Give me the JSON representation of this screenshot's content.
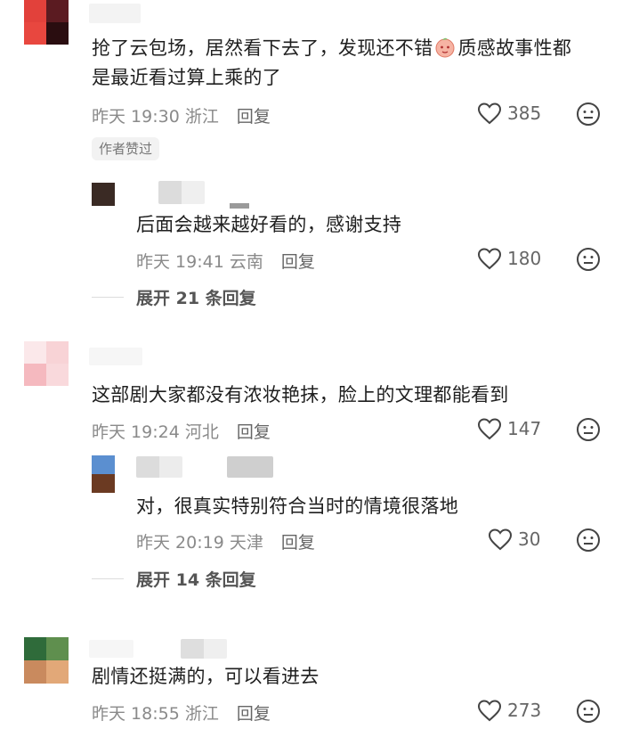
{
  "comments": [
    {
      "text_line1": "抢了云包场，居然看下去了，发现还不错",
      "text_line1b": "质感故事性都",
      "text_line2": "是最近看过算上乘的了",
      "time": "昨天 19:30",
      "location": "浙江",
      "reply_label": "回复",
      "likes": "385",
      "author_tag": "作者赞过",
      "reply": {
        "text": "后面会越来越好看的，感谢支持",
        "time": "昨天 19:41",
        "location": "云南",
        "reply_label": "回复",
        "likes": "180"
      },
      "expand_label": "展开 21 条回复"
    },
    {
      "text": "这部剧大家都没有浓妆艳抹，脸上的文理都能看到",
      "time": "昨天 19:24",
      "location": "河北",
      "reply_label": "回复",
      "likes": "147",
      "reply": {
        "text": "对，很真实特别符合当时的情境很落地",
        "time": "昨天 20:19",
        "location": "天津",
        "reply_label": "回复",
        "likes": "30"
      },
      "expand_label": "展开 14 条回复"
    },
    {
      "text": "剧情还挺满的，可以看进去",
      "time": "昨天 18:55",
      "location": "浙江",
      "reply_label": "回复",
      "likes": "273"
    }
  ],
  "icons": {
    "heart": "heart-icon",
    "emoji": "emoji-react-icon",
    "peach": "peach-emoji"
  }
}
